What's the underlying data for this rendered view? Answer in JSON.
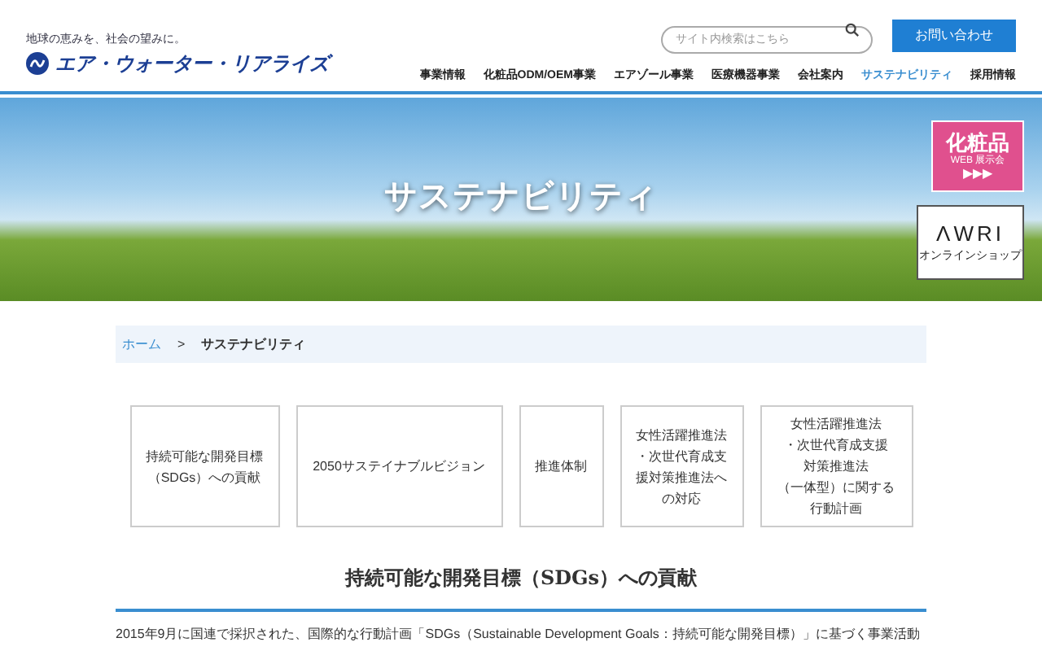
{
  "header": {
    "tagline": "地球の恵みを、社会の望みに。",
    "logo_text": "エア・ウォーター・リアライズ",
    "search": {
      "placeholder": "サイト内検索はこちら"
    },
    "contact_button": "お問い合わせ",
    "nav": [
      {
        "label": "事業情報",
        "selected": false
      },
      {
        "label": "化粧品ODM/OEM事業",
        "selected": false
      },
      {
        "label": "エアゾール事業",
        "selected": false
      },
      {
        "label": "医療機器事業",
        "selected": false
      },
      {
        "label": "会社案内",
        "selected": false
      },
      {
        "label": "サステナビリティ",
        "selected": true
      },
      {
        "label": "採用情報",
        "selected": false
      }
    ]
  },
  "hero": {
    "title": "サステナビリティ"
  },
  "side_banners": {
    "cosmetics": {
      "title": "化粧品",
      "subtitle": "WEB 展示会",
      "arrows": "▶▶▶"
    },
    "shop": {
      "logo": "ΛWRI",
      "subtitle": "オンラインショップ"
    }
  },
  "breadcrumb": [
    {
      "label": "ホーム",
      "kind": "link"
    },
    {
      "label": ">",
      "kind": "separator"
    },
    {
      "label": "サステナビリティ",
      "kind": "current"
    }
  ],
  "cards": [
    {
      "lines": [
        "持続可能な開発目標",
        "（SDGs）への貢献"
      ]
    },
    {
      "lines": [
        "2050サステイナブルビジョン"
      ]
    },
    {
      "lines": [
        "推進体制"
      ]
    },
    {
      "lines": [
        "女性活躍推進法",
        "・次世代育成支",
        "援対策推進法へ",
        "の対応"
      ]
    },
    {
      "lines": [
        "女性活躍推進法",
        "・次世代育成支援",
        "対策推進法",
        "（一体型）に関する",
        "行動計画"
      ]
    }
  ],
  "section": {
    "title": "持続可能な開発目標（SDGs）への貢献",
    "body": "2015年9月に国連で採択された、国際的な行動計画「SDGs（Sustainable Development Goals：持続可能な開発目標）」に基づく事業活動"
  }
}
